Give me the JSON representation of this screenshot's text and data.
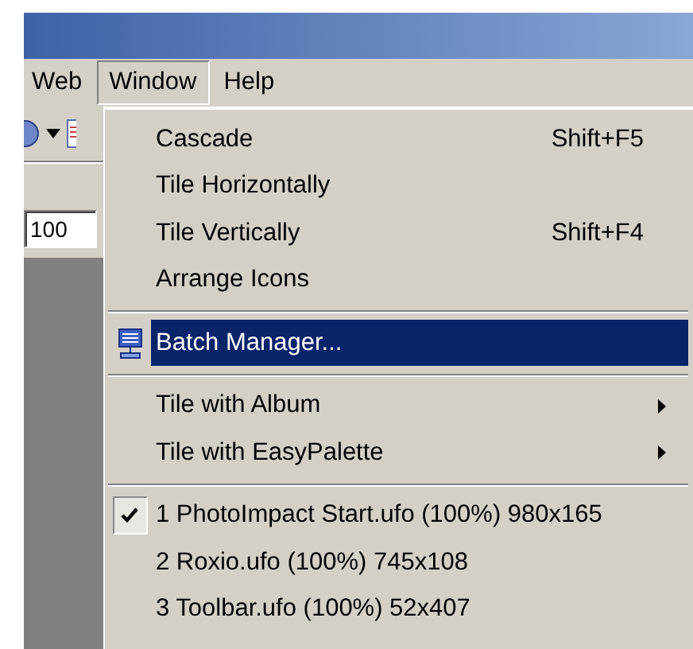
{
  "menubar": [
    {
      "label": "Web",
      "selected": false
    },
    {
      "label": "Window",
      "selected": true
    },
    {
      "label": "Help",
      "selected": false
    }
  ],
  "zoom_field": {
    "value": "100"
  },
  "window_menu": [
    {
      "kind": "item",
      "label": "Cascade",
      "shortcut": "Shift+F5",
      "selected": false
    },
    {
      "kind": "item",
      "label": "Tile Horizontally",
      "selected": false
    },
    {
      "kind": "item",
      "label": "Tile Vertically",
      "shortcut": "Shift+F4",
      "selected": false
    },
    {
      "kind": "item",
      "label": "Arrange Icons",
      "selected": false
    },
    {
      "kind": "separator"
    },
    {
      "kind": "item",
      "label": "Batch Manager...",
      "icon": true,
      "selected": true
    },
    {
      "kind": "separator"
    },
    {
      "kind": "submenu",
      "label": "Tile with Album",
      "selected": false
    },
    {
      "kind": "submenu",
      "label": "Tile with EasyPalette",
      "selected": false
    },
    {
      "kind": "separator"
    },
    {
      "kind": "window",
      "label": "1 PhotoImpact Start.ufo (100%) 980x165",
      "checked": true,
      "selected": false
    },
    {
      "kind": "window",
      "label": "2 Roxio.ufo (100%) 745x108",
      "checked": false,
      "selected": false
    },
    {
      "kind": "window",
      "label": "3 Toolbar.ufo (100%) 52x407",
      "checked": false,
      "selected": false
    }
  ]
}
